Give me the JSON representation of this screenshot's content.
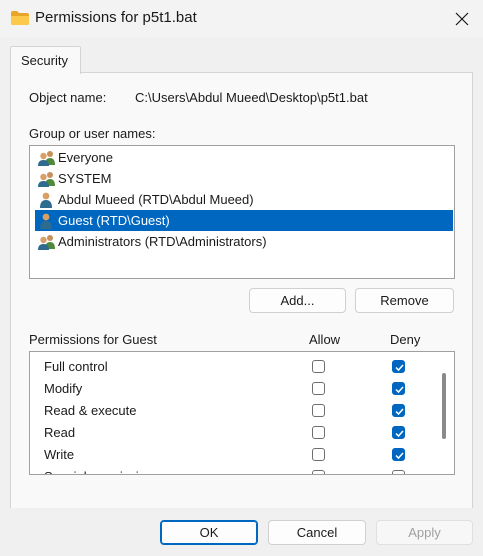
{
  "window": {
    "title": "Permissions for p5t1.bat",
    "folder_icon": "folder-icon",
    "close_icon": "close-icon"
  },
  "tabs": [
    {
      "label": "Security",
      "selected": true
    }
  ],
  "object": {
    "label": "Object name:",
    "value": "C:\\Users\\Abdul Mueed\\Desktop\\p5t1.bat"
  },
  "groups": {
    "label": "Group or user names:",
    "items": [
      {
        "name": "Everyone",
        "icon": "users-group-icon",
        "selected": false
      },
      {
        "name": "SYSTEM",
        "icon": "users-group-icon",
        "selected": false
      },
      {
        "name": "Abdul Mueed (RTD\\Abdul Mueed)",
        "icon": "user-icon",
        "selected": false
      },
      {
        "name": "Guest (RTD\\Guest)",
        "icon": "user-icon",
        "selected": true
      },
      {
        "name": "Administrators (RTD\\Administrators)",
        "icon": "users-group-icon",
        "selected": false
      }
    ],
    "add_label": "Add...",
    "remove_label": "Remove"
  },
  "permissions": {
    "label": "Permissions for Guest",
    "allow_header": "Allow",
    "deny_header": "Deny",
    "rows": [
      {
        "name": "Full control",
        "allow": false,
        "deny": true
      },
      {
        "name": "Modify",
        "allow": false,
        "deny": true
      },
      {
        "name": "Read & execute",
        "allow": false,
        "deny": true
      },
      {
        "name": "Read",
        "allow": false,
        "deny": true
      },
      {
        "name": "Write",
        "allow": false,
        "deny": true
      },
      {
        "name": "Special permissions",
        "allow": false,
        "deny": false
      }
    ]
  },
  "footer": {
    "ok_label": "OK",
    "cancel_label": "Cancel",
    "apply_label": "Apply"
  },
  "colors": {
    "accent": "#0067c0",
    "window_bg": "#f0f0f0"
  }
}
